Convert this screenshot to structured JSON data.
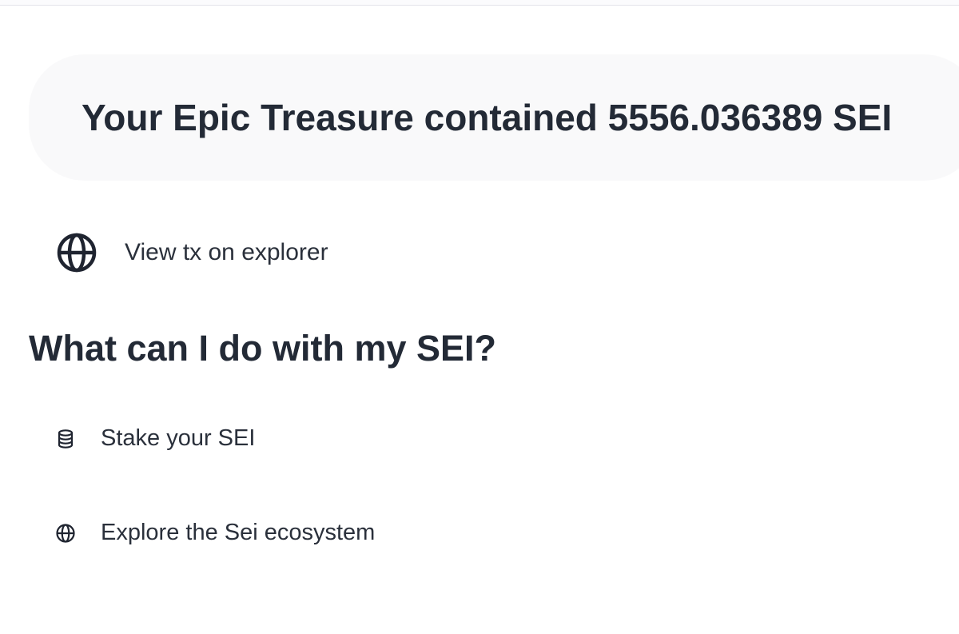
{
  "result": {
    "title": "Your Epic Treasure contained 5556.036389 SEI"
  },
  "links": {
    "view_tx": {
      "label": "View tx on explorer",
      "icon": "globe-icon"
    }
  },
  "section": {
    "heading": "What can I do with my SEI?",
    "actions": [
      {
        "label": "Stake your SEI",
        "icon": "database-icon"
      },
      {
        "label": "Explore the Sei ecosystem",
        "icon": "globe-icon"
      }
    ]
  },
  "colors": {
    "text": "#232a36",
    "banner_bg": "#f9f9fa",
    "page_bg": "#ffffff"
  }
}
